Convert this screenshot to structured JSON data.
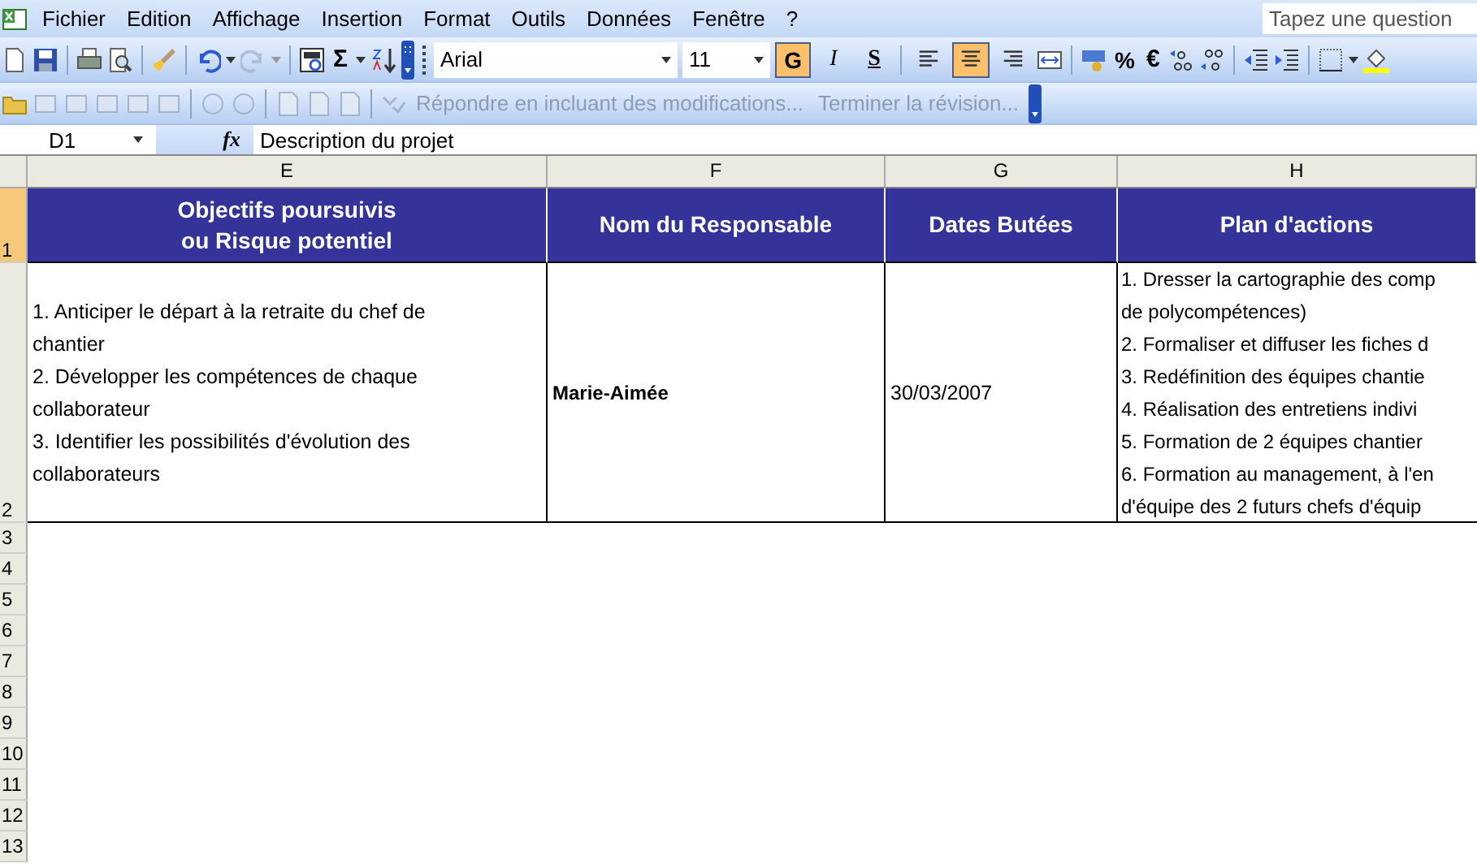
{
  "menu": [
    {
      "label": "Fichier"
    },
    {
      "label": "Edition"
    },
    {
      "label": "Affichage"
    },
    {
      "label": "Insertion"
    },
    {
      "label": "Format"
    },
    {
      "label": "Outils"
    },
    {
      "label": "Données"
    },
    {
      "label": "Fenêtre"
    },
    {
      "label": "?"
    }
  ],
  "help_box": {
    "placeholder": "Tapez une question"
  },
  "standard_toolbar": {
    "sum": "Σ",
    "redo_disabled": true
  },
  "format_toolbar": {
    "font": "Arial",
    "size": "11",
    "styles": [
      {
        "label": "G",
        "kind": "bold",
        "selected": true
      },
      {
        "label": "I",
        "kind": "italic",
        "selected": false
      },
      {
        "label": "S",
        "kind": "underline",
        "selected": false
      }
    ],
    "alignment": [
      {
        "kind": "left",
        "selected": false
      },
      {
        "kind": "center",
        "selected": true
      },
      {
        "kind": "right",
        "selected": false
      }
    ],
    "percent": "%",
    "euro": "€"
  },
  "review_toolbar": {
    "reply": "Répondre en incluant des modifications...",
    "end_review": "Terminer la révision...",
    "disabled": true
  },
  "formula_bar": {
    "name_box": "D1",
    "function_label": "fx",
    "formula": "Description du projet"
  },
  "sheet": {
    "columns": [
      "E",
      "F",
      "G",
      "H"
    ],
    "header_row": {
      "number": "1",
      "selected": true,
      "cells": [
        "Objectifs poursuivis\nou Risque potentiel",
        "Nom du Responsable",
        "Dates Butées",
        "Plan d'actions"
      ]
    },
    "data_row": {
      "number": "2",
      "selected": false,
      "objectives": [
        "1. Anticiper le départ à la retraite du chef de chantier",
        "2. Développer les compétences de chaque collaborateur",
        "3. Identifier les possibilités d'évolution des collaborateurs"
      ],
      "responsible": "Marie-Aimée",
      "date": "30/03/2007",
      "actions": [
        "1. Dresser la cartographie des comp",
        "de polycompétences)",
        "2. Formaliser et diffuser les fiches d",
        "3. Redéfinition des équipes chantie",
        "4. Réalisation des entretiens indivi",
        "5. Formation de 2 équipes chantier",
        "6. Formation au management, à l'en",
        "d'équipe des 2 futurs chefs d'équip"
      ]
    },
    "empty_rows": [
      {
        "number": "3",
        "selected": false
      },
      {
        "number": "4",
        "selected": false
      },
      {
        "number": "5",
        "selected": false
      },
      {
        "number": "6",
        "selected": false
      },
      {
        "number": "7",
        "selected": false
      },
      {
        "number": "8",
        "selected": false
      },
      {
        "number": "9",
        "selected": false
      },
      {
        "number": "10",
        "selected": false
      },
      {
        "number": "11",
        "selected": false
      },
      {
        "number": "12",
        "selected": false
      },
      {
        "number": "13",
        "selected": false
      }
    ]
  }
}
